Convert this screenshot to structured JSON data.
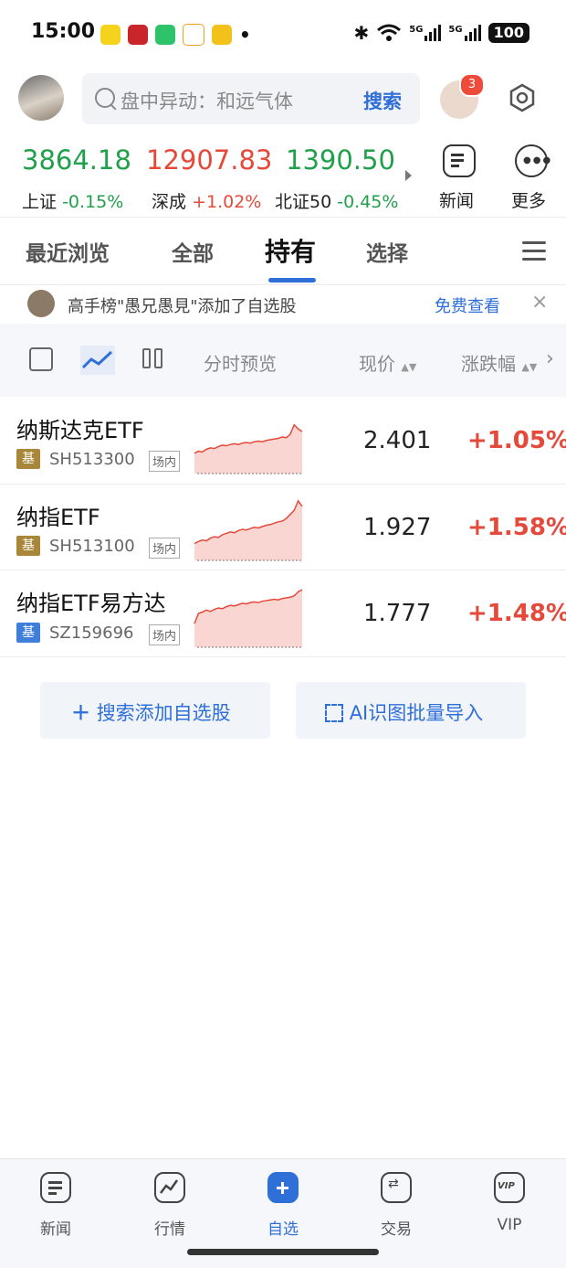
{
  "status_bar": {
    "time": "15:00",
    "dot": "•",
    "signal1": "5G",
    "signal2": "5G",
    "battery": "100"
  },
  "header": {
    "search_placeholder": "盘中异动：和远气体",
    "search_button": "搜索",
    "message_count": "3"
  },
  "indices": [
    {
      "value": "3864.18",
      "name": "上证",
      "change": "-0.15%",
      "trend": "down"
    },
    {
      "value": "12907.83",
      "name": "深成",
      "change": "+1.02%",
      "trend": "up"
    },
    {
      "value": "1390.50",
      "name": "北证50",
      "change": "-0.45%",
      "trend": "down"
    }
  ],
  "quick_buttons": [
    {
      "label": "新闻",
      "icon": "news-icon"
    },
    {
      "label": "更多",
      "icon": "more-icon"
    }
  ],
  "tabs": [
    "最近浏览",
    "全部",
    "持有",
    "选择"
  ],
  "active_tab": "持有",
  "banner": {
    "text": "高手榜\"愚兄愚見\"添加了自选股",
    "link": "免费查看",
    "close": "×"
  },
  "columns": {
    "preview": "分时预览",
    "price": "现价",
    "change": "涨跌幅"
  },
  "stocks": [
    {
      "name": "纳斯达克ETF",
      "badge": "基",
      "badge_color": "#a8873a",
      "code": "SH513300",
      "tag": "场内",
      "price": "2.401",
      "change": "+1.05%",
      "spark": [
        0.3,
        0.33,
        0.32,
        0.36,
        0.38,
        0.37,
        0.4,
        0.42,
        0.41,
        0.43,
        0.44,
        0.43,
        0.45,
        0.46,
        0.45,
        0.47,
        0.48,
        0.47,
        0.49,
        0.5,
        0.51,
        0.52,
        0.54,
        0.53,
        0.58,
        0.72,
        0.66,
        0.62
      ]
    },
    {
      "name": "纳指ETF",
      "badge": "基",
      "badge_color": "#a8873a",
      "code": "SH513100",
      "tag": "场内",
      "price": "1.927",
      "change": "+1.58%",
      "spark": [
        0.25,
        0.28,
        0.3,
        0.29,
        0.33,
        0.35,
        0.34,
        0.38,
        0.4,
        0.42,
        0.41,
        0.44,
        0.46,
        0.45,
        0.47,
        0.49,
        0.48,
        0.5,
        0.52,
        0.53,
        0.55,
        0.57,
        0.58,
        0.62,
        0.68,
        0.74,
        0.88,
        0.8
      ]
    },
    {
      "name": "纳指ETF易方达",
      "badge": "基",
      "badge_color": "#3f7fd9",
      "code": "SZ159696",
      "tag": "场内",
      "price": "1.777",
      "change": "+1.48%",
      "spark": [
        0.35,
        0.5,
        0.52,
        0.55,
        0.53,
        0.56,
        0.58,
        0.57,
        0.6,
        0.62,
        0.61,
        0.63,
        0.65,
        0.64,
        0.66,
        0.67,
        0.66,
        0.68,
        0.69,
        0.7,
        0.71,
        0.7,
        0.72,
        0.73,
        0.74,
        0.76,
        0.82,
        0.85
      ]
    }
  ],
  "actions": {
    "add": "搜索添加自选股",
    "ai_import": "AI识图批量导入"
  },
  "bottom_nav": [
    {
      "label": "新闻",
      "icon": "news-icon"
    },
    {
      "label": "行情",
      "icon": "chart-icon"
    },
    {
      "label": "自选",
      "icon": "plus-icon"
    },
    {
      "label": "交易",
      "icon": "exchange-icon"
    },
    {
      "label": "VIP",
      "icon": "vip-icon"
    }
  ],
  "active_nav": "自选",
  "colors": {
    "accent": "#2f6fd8",
    "up": "#e5493a",
    "down": "#21a04b"
  }
}
